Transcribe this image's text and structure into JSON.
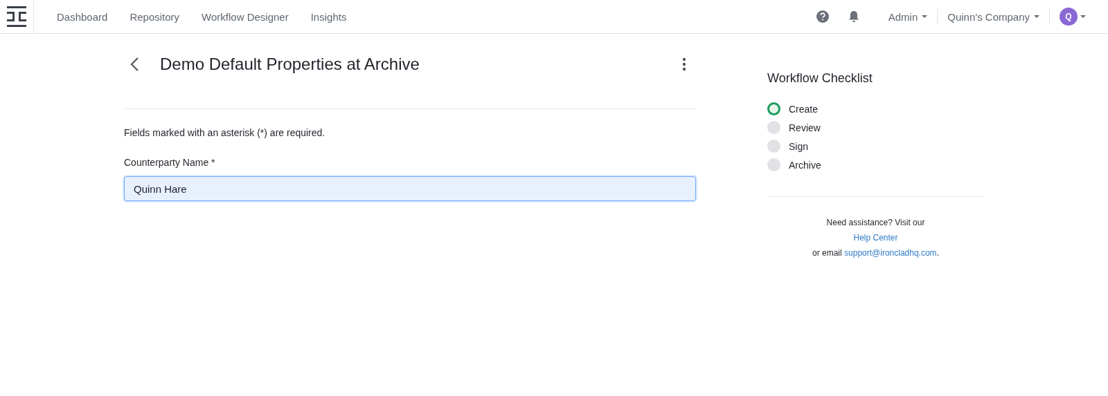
{
  "nav": {
    "items": [
      {
        "label": "Dashboard"
      },
      {
        "label": "Repository"
      },
      {
        "label": "Workflow Designer"
      },
      {
        "label": "Insights"
      }
    ],
    "admin_menu": "Admin",
    "company_menu": "Quinn's Company",
    "avatar": "Q"
  },
  "page": {
    "title": "Demo Default Properties at Archive",
    "note": "Fields marked with an asterisk (*) are required.",
    "field": {
      "label": "Counterparty Name *",
      "value": "Quinn Hare",
      "focused": true
    }
  },
  "checklist": {
    "title": "Workflow Checklist",
    "steps": [
      {
        "label": "Create",
        "selected": true
      },
      {
        "label": "Review",
        "selected": false
      },
      {
        "label": "Sign",
        "selected": false
      },
      {
        "label": "Archive",
        "selected": false
      }
    ]
  },
  "help": {
    "line_1": "Need assistance? Visit our",
    "link_1": "Help Center",
    "line_3_before": "or email ",
    "link_2": "support@ironcladhq.com",
    "line_3_after": "."
  }
}
